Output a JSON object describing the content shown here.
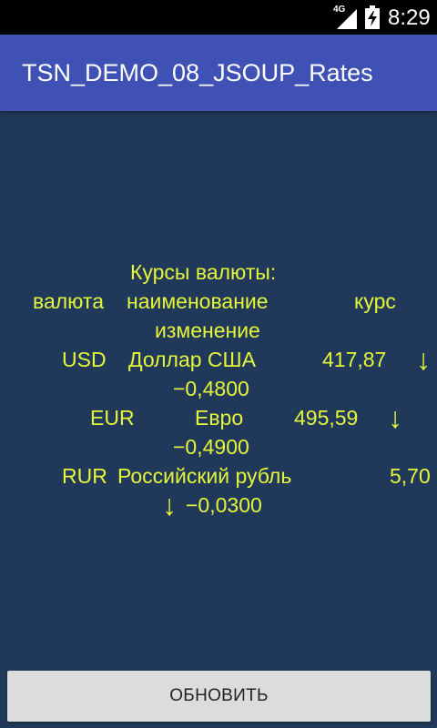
{
  "status_bar": {
    "network": "4G",
    "time": "8:29",
    "icons": [
      "signal-icon",
      "battery-charging-icon"
    ]
  },
  "app": {
    "title": "TSN_DEMO_08_JSOUP_Rates"
  },
  "rates": {
    "heading": "Курсы валюты:",
    "columns": {
      "currency": "валюта",
      "name": "наименование",
      "rate": "курс",
      "change": "изменение"
    },
    "rows": [
      {
        "code": "USD",
        "name": "Доллар США",
        "rate": "417,87",
        "direction_icon": "arrow-down-icon",
        "arrow": "↓",
        "change": "−0,4800"
      },
      {
        "code": "EUR",
        "name": "Евро",
        "rate": "495,59",
        "direction_icon": "arrow-down-icon",
        "arrow": "↓",
        "change": "−0,4900"
      },
      {
        "code": "RUR",
        "name": "Российский рубль",
        "rate": "5,70",
        "direction_icon": "arrow-down-icon",
        "arrow": "↓",
        "change": "−0,0300"
      }
    ]
  },
  "actions": {
    "update_label": "ОБНОВИТЬ"
  },
  "colors": {
    "background": "#20395a",
    "app_bar": "#3f51b5",
    "text_accent": "#e5f53a",
    "button": "#dcdcdc"
  }
}
